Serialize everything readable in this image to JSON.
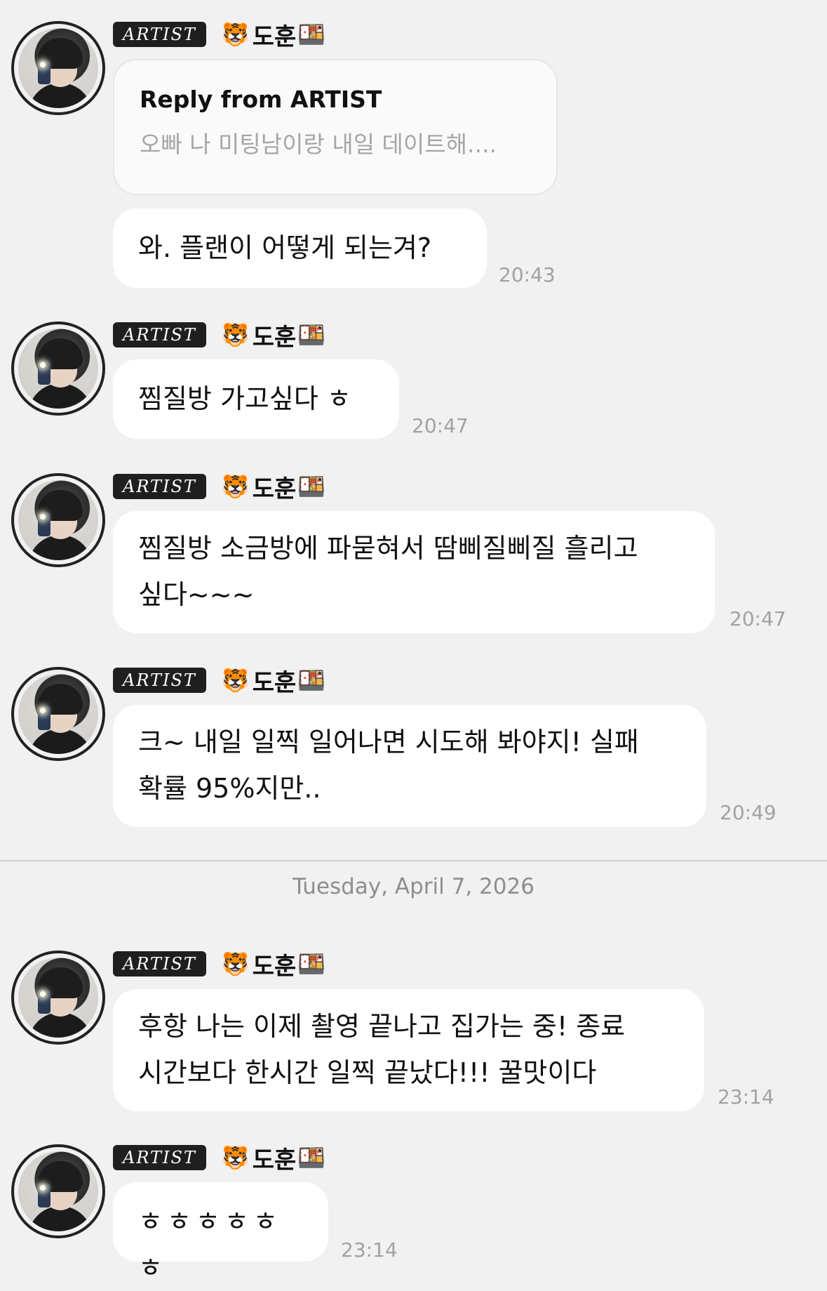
{
  "messages": [
    {
      "badge": "ARTIST",
      "emoji_before": "🐯",
      "name": "도훈",
      "emoji_after": "🍱",
      "reply": {
        "title": "Reply from ARTIST",
        "quote": "오빠 나 미팅남이랑 내일 데이트해...."
      },
      "text": "와. 플랜이 어떻게 되는겨?",
      "time": "20:43"
    },
    {
      "badge": "ARTIST",
      "emoji_before": "🐯",
      "name": "도훈",
      "emoji_after": "🍱",
      "text": "찜질방 가고싶다 ㅎ",
      "time": "20:47"
    },
    {
      "badge": "ARTIST",
      "emoji_before": "🐯",
      "name": "도훈",
      "emoji_after": "🍱",
      "text_lines": [
        "찜질방 소금방에 파묻혀서 땀삐질삐질 흘리고",
        "싶다~~~"
      ],
      "time": "20:47"
    },
    {
      "badge": "ARTIST",
      "emoji_before": "🐯",
      "name": "도훈",
      "emoji_after": "🍱",
      "text_lines": [
        "크~ 내일 일찍 일어나면 시도해 봐야지! 실패",
        "확률 95%지만.."
      ],
      "time": "20:49"
    },
    {
      "badge": "ARTIST",
      "emoji_before": "🐯",
      "name": "도훈",
      "emoji_after": "🍱",
      "text_lines": [
        "후항 나는 이제 촬영 끝나고 집가는 중! 종료",
        "시간보다 한시간 일찍 끝났다!!! 꿀맛이다"
      ],
      "time": "23:14"
    },
    {
      "badge": "ARTIST",
      "emoji_before": "🐯",
      "name": "도훈",
      "emoji_after": "🍱",
      "text": "ㅎㅎㅎㅎㅎㅎ",
      "time": "23:14"
    }
  ],
  "date_separator": "Tuesday, April 7, 2026",
  "colors": {
    "background": "#f1f1f1",
    "bubble": "#ffffff",
    "badge": "#1f1f1f",
    "time": "#a2a2a2",
    "quote": "#a6a6a6"
  }
}
